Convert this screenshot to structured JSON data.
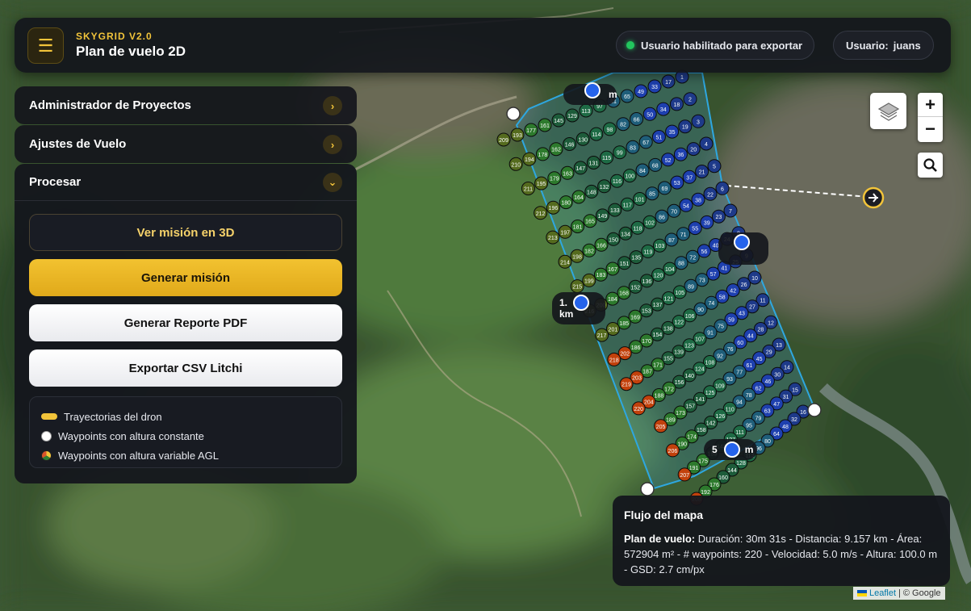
{
  "header": {
    "brand": "SKYGRID V2.0",
    "title": "Plan de vuelo 2D",
    "status": "Usuario habilitado para exportar",
    "user_label": "Usuario:",
    "user_name": "juans"
  },
  "panel": {
    "accordions": [
      {
        "label": "Administrador de Proyectos",
        "icon": "chevron-right-icon"
      },
      {
        "label": "Ajustes de Vuelo",
        "icon": "chevron-right-icon"
      }
    ],
    "process": {
      "label": "Procesar",
      "icon": "chevron-down-icon",
      "buttons": {
        "view3d": "Ver misión en 3D",
        "generate": "Generar misión",
        "pdf": "Generar Reporte PDF",
        "csv": "Exportar CSV Litchi"
      },
      "legend": [
        "Trayectorias del dron",
        "Waypoints con altura constante",
        "Waypoints con altura variable AGL"
      ]
    }
  },
  "map": {
    "distance_labels": [
      "m",
      "1.",
      "km",
      "5",
      "m"
    ],
    "controls": {
      "zoom_in": "+",
      "zoom_out": "−"
    },
    "waypoint_count": 220
  },
  "info": {
    "title": "Flujo del mapa",
    "plan_label": "Plan de vuelo:",
    "text": "Duración: 30m 31s - Distancia: 9.157 km - Área: 572904 m² - # waypoints: 220 - Velocidad: 5.0 m/s - Altura: 100.0 m - GSD: 2.7 cm/px"
  },
  "attribution": {
    "leaflet": "Leaflet",
    "separator": "|",
    "google": "© Google"
  },
  "colors": {
    "accent": "#f2c43a",
    "status": "#22c55e",
    "panel": "#14161c"
  }
}
